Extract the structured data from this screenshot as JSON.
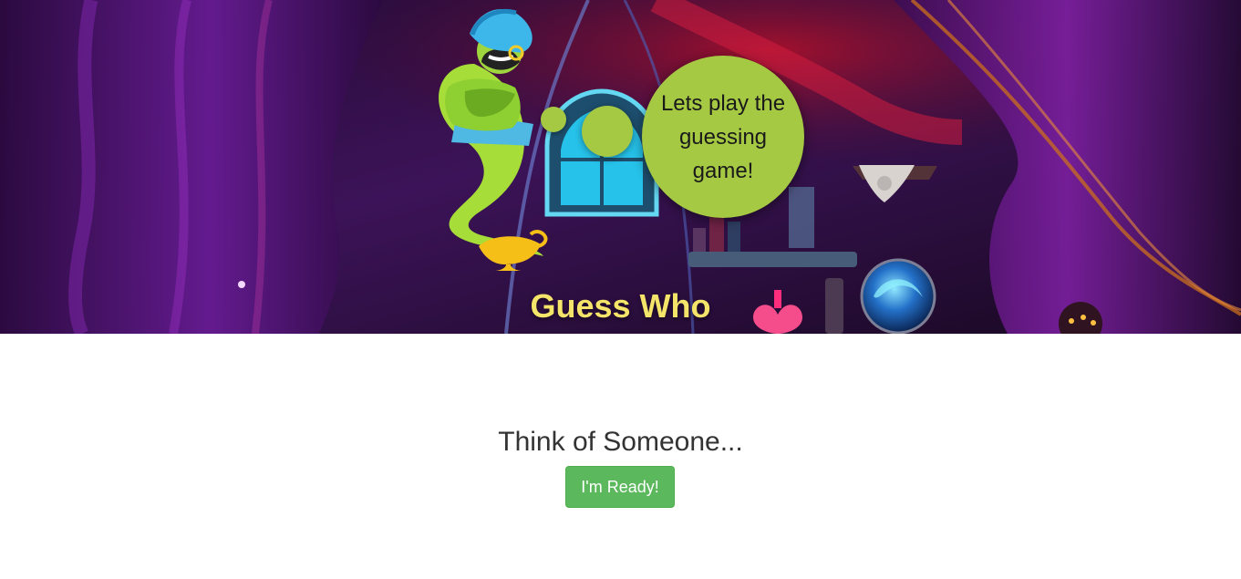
{
  "header": {
    "speech_bubble_text": "Lets play the guessing game!",
    "title": "Guess Who",
    "mascot_icon": "genie-icon",
    "lamp_icon": "magic-lamp-icon"
  },
  "main": {
    "prompt": "Think of Someone...",
    "ready_button_label": "I'm Ready!"
  },
  "colors": {
    "bubble": "#a6c944",
    "title": "#f4e46a",
    "button": "#5cb85c",
    "hero_background": "#2a0f3d"
  }
}
